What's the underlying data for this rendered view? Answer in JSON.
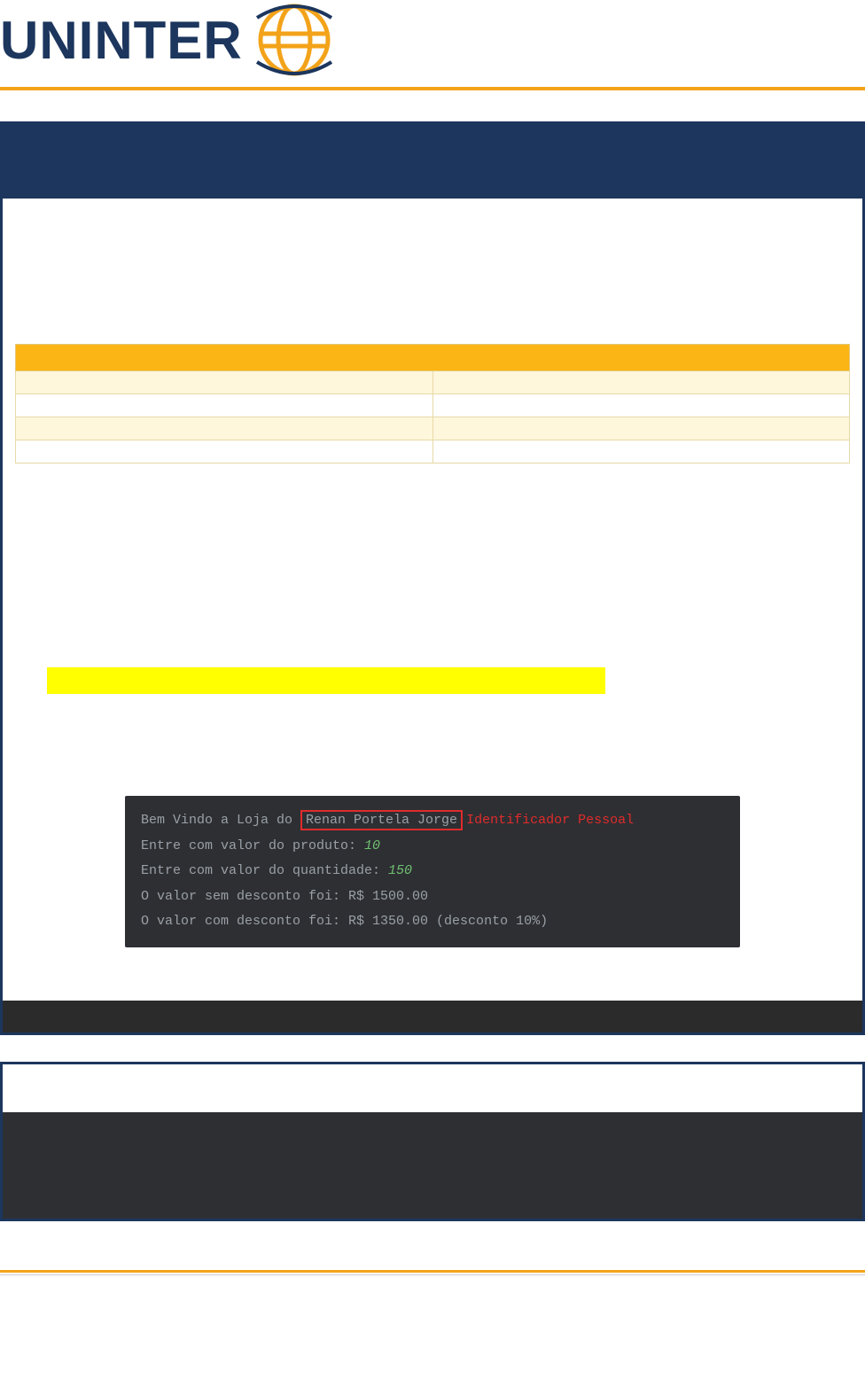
{
  "logo": {
    "brand": "UNINTER"
  },
  "terminal": {
    "line1_prefix": "Bem Vindo a Loja do ",
    "line1_name": "Renan Portela Jorge",
    "line1_tag": "Identificador Pessoal",
    "line2_label": "Entre com valor do produto: ",
    "line2_val": "10",
    "line3_label": "Entre com valor do quantidade: ",
    "line3_val": "150",
    "line4": "O valor sem desconto foi: R$ 1500.00",
    "line5": "O valor com desconto foi: R$ 1350.00  (desconto 10%)"
  }
}
